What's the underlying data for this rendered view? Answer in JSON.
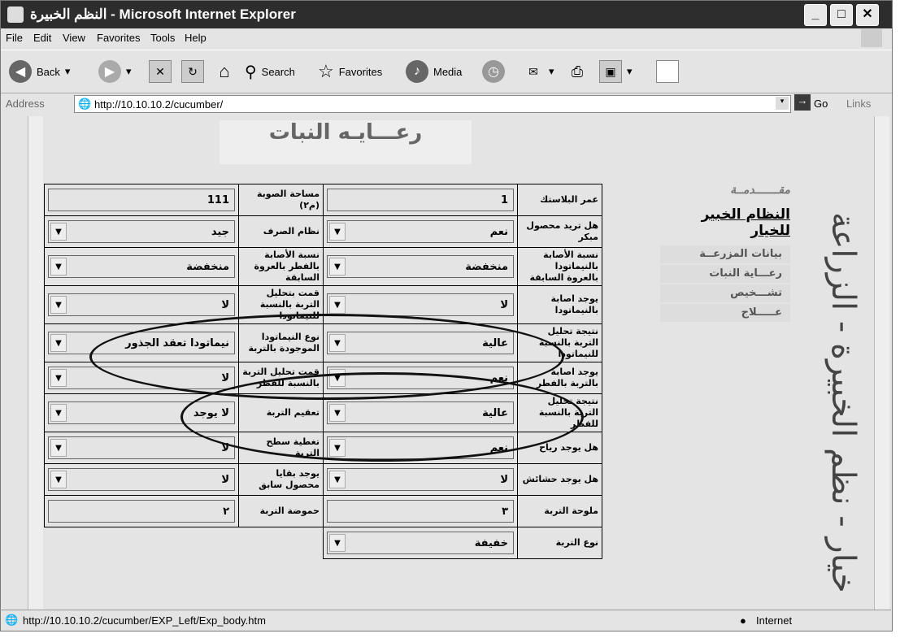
{
  "window": {
    "title": "النظم الخبيرة - Microsoft Internet Explorer"
  },
  "menu": [
    "File",
    "Edit",
    "View",
    "Favorites",
    "Tools",
    "Help"
  ],
  "toolbar": {
    "back": "Back",
    "search": "Search",
    "favorites": "Favorites",
    "media": "Media"
  },
  "address": {
    "label": "Address",
    "url": "http://10.10.10.2/cucumber/",
    "go": "Go",
    "links": "Links"
  },
  "banner": "رعـــايـه النبات",
  "sidebar": {
    "intro": "مقـــــــدمــة",
    "title": "النظام الخبير للخيار",
    "items": [
      "بيانات المزرعــة",
      "رعـــاية النبات",
      "تشـــخيص",
      "عـــــلاج"
    ],
    "vertical_title": "خيار - نظم الخبيرة - الزراعة"
  },
  "rows": [
    {
      "l1": "عمر البلاستك",
      "v1": "1",
      "d1": false,
      "l2": "مساحة الصوبة (م٢)",
      "v2": "111",
      "d2": false
    },
    {
      "l1": "هل تريد محصول مبكر",
      "v1": "نعم",
      "d1": true,
      "l2": "نظام الصرف",
      "v2": "جيد",
      "d2": true
    },
    {
      "l1": "نسبة الأصابة بالنيماتودا بالعروة السابقة",
      "v1": "منخفضة",
      "d1": true,
      "l2": "نسبة الأصابة بالفطر بالعروة السابقة",
      "v2": "منخفضة",
      "d2": true
    },
    {
      "l1": "يوجد اصابة بالنيماتودا",
      "v1": "لا",
      "d1": true,
      "l2": "قمت بتحليل التربة بالنسبة للنيماتودا",
      "v2": "لا",
      "d2": true
    },
    {
      "l1": "نتيجة تحليل التربة بالنسبة للنيماتودا",
      "v1": "عالية",
      "d1": true,
      "l2": "نوع النيماتودا الموجودة بالتربة",
      "v2": "نيماتودا تعقد الجذور",
      "d2": true
    },
    {
      "l1": "يوجد اصابة بالتربة بالفطر",
      "v1": "نعم",
      "d1": true,
      "l2": "قمت تحليل التربة بالنسبة للفطر",
      "v2": "لا",
      "d2": true
    },
    {
      "l1": "نتيجة تحليل التربة بالنسبة للفطر",
      "v1": "عالية",
      "d1": true,
      "l2": "تعقيم التربة",
      "v2": "لا يوجد",
      "d2": true
    },
    {
      "l1": "هل يوجد رياح",
      "v1": "نعم",
      "d1": true,
      "l2": "تغطية سطح التربة",
      "v2": "لا",
      "d2": true
    },
    {
      "l1": "هل يوجد حشائش",
      "v1": "لا",
      "d1": true,
      "l2": "يوجد بقايا محصول سابق",
      "v2": "لا",
      "d2": true
    },
    {
      "l1": "ملوحة التربة",
      "v1": "٣",
      "d1": false,
      "l2": "حموضة التربة",
      "v2": "٢",
      "d2": false
    },
    {
      "l1": "نوع التربة",
      "v1": "خفيفة",
      "d1": true,
      "l2": "",
      "v2": "",
      "d2": false
    }
  ],
  "status": {
    "url": "http://10.10.10.2/cucumber/EXP_Left/Exp_body.htm",
    "zone": "Internet"
  }
}
